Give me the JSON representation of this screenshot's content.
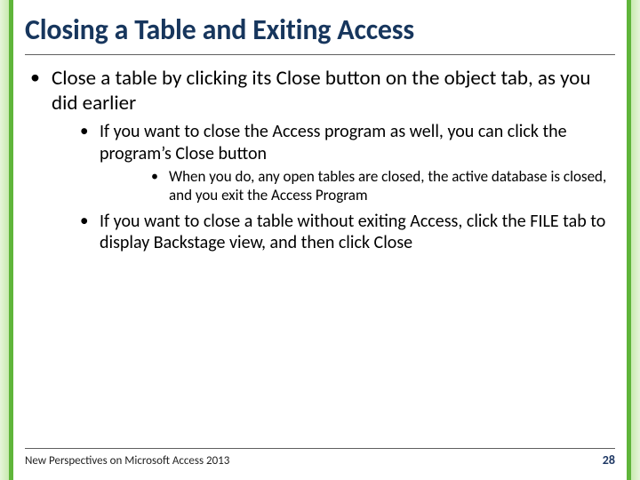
{
  "title": "Closing a Table and Exiting Access",
  "bullets": {
    "b1": "Close a table by clicking its Close button on the object tab, as you did earlier",
    "b1_1": "If you want to close the Access program as well, you can click the program’s Close button",
    "b1_1_1": "When you do, any open tables are closed, the active database is closed, and you exit the Access Program",
    "b1_2": "If you want to close a table without exiting Access, click the FILE tab to display Backstage view, and then click Close"
  },
  "footer": {
    "text": "New Perspectives on Microsoft Access 2013",
    "page": "28"
  },
  "colors": {
    "title": "#17365D",
    "accent": "#5fb53a"
  }
}
